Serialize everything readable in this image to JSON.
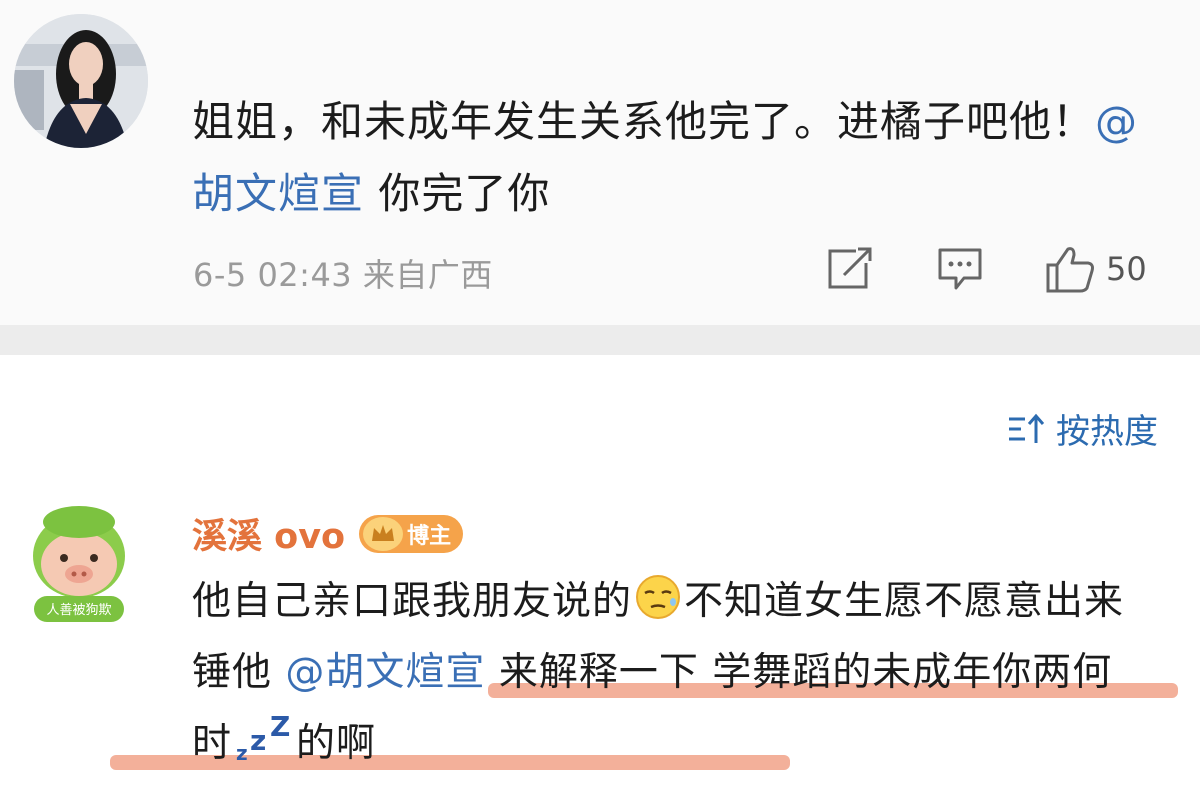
{
  "post": {
    "text_1": "姐姐，和未成年发生关系他完了。进橘子吧他！",
    "mention": "@胡文煊宣",
    "text_2": " 你完了你",
    "timestamp": "6-5 02:43",
    "location": "来自广西",
    "like_count": "50"
  },
  "sort": {
    "label": "按热度"
  },
  "comment": {
    "username": "溪溪 ovo",
    "badge_label": "博主",
    "avatar_label": "人善被狗欺",
    "text_1": "他自己亲口跟我朋友说的",
    "text_2": "不知道女生愿不愿意出来锤他 ",
    "mention": "@胡文煊宣",
    "text_3": " 来解释一下 学舞蹈的未成年你两何时",
    "text_4": "的啊"
  },
  "colors": {
    "mention": "#3a6fb5",
    "username": "#e3733c",
    "badge": "#f5a34a",
    "highlight": "#ec805c",
    "meta": "#9a9a9a"
  },
  "icons": [
    "share-icon",
    "comment-icon",
    "thumbs-up-icon",
    "sort-icon",
    "sleepy-emoji-icon",
    "sleeping-zz-icon",
    "crown-icon"
  ]
}
